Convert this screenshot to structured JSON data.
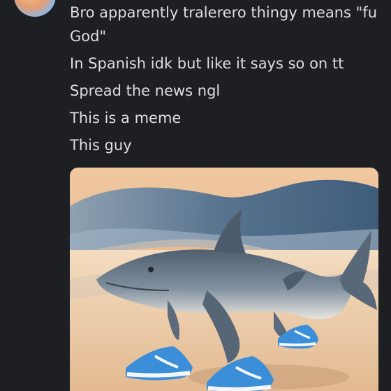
{
  "message": {
    "lines": [
      "Bro apparently tralerero thingy means \"fu God\"",
      "In Spanish idk but like it says so on tt",
      "Spread the news ngl",
      "This is a meme",
      "This guy"
    ]
  },
  "attachment": {
    "subject": "shark wearing blue sneakers on beach",
    "colors": {
      "wave": "#5f7f9c",
      "sand": "#e8c7a0",
      "shark": "#6f7f8f",
      "sneaker": "#3b8fd9"
    }
  }
}
